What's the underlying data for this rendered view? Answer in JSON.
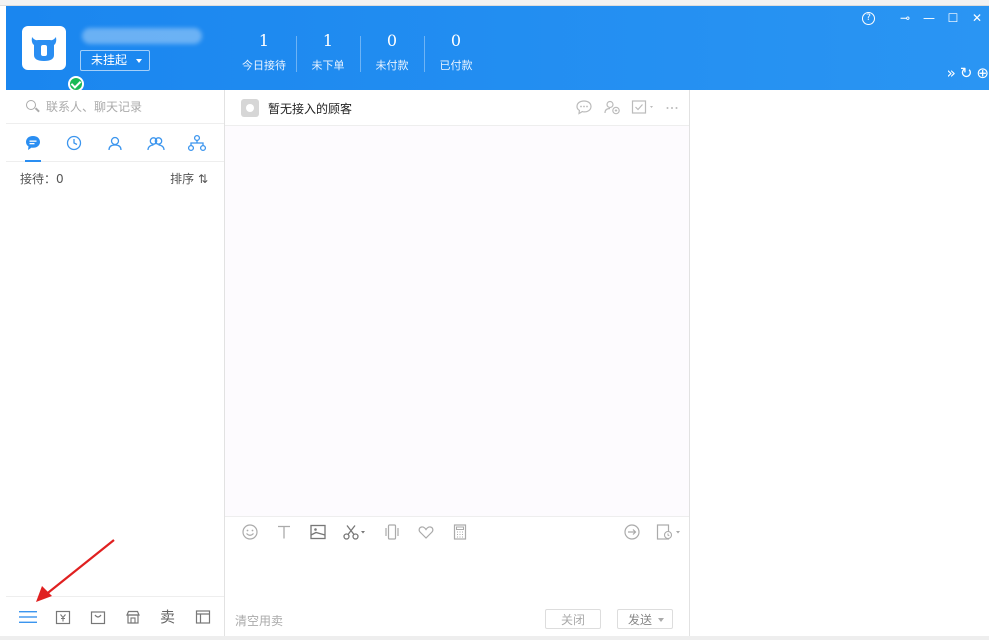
{
  "header": {
    "status_label": "未挂起",
    "stats": [
      {
        "value": "1",
        "label": "今日接待"
      },
      {
        "value": "1",
        "label": "未下单"
      },
      {
        "value": "0",
        "label": "未付款"
      },
      {
        "value": "0",
        "label": "已付款"
      }
    ],
    "help_glyph": "?",
    "pin_glyph": "⊸",
    "min_glyph": "—",
    "max_glyph": "☐",
    "close_glyph": "✕",
    "tool_expand_glyph": "»",
    "tool_refresh_glyph": "↻",
    "tool_add_glyph": "⊕",
    "accent_color": "#1e90f0"
  },
  "left": {
    "search_placeholder": "联系人、聊天记录",
    "tabs": [
      {
        "icon": "chat-bubble-icon",
        "active": true
      },
      {
        "icon": "clock-icon",
        "active": false
      },
      {
        "icon": "contact-icon",
        "active": false
      },
      {
        "icon": "group-icon",
        "active": false
      },
      {
        "icon": "org-tree-icon",
        "active": false
      }
    ],
    "reception_label": "接待：0",
    "sort_label": "排序 ⇅",
    "bottom": {
      "sell_label": "卖"
    }
  },
  "chat": {
    "customer_name": "暂无接入的顾客",
    "clear_label": "清空用卖",
    "close_label": "关闭",
    "send_label": "发送"
  }
}
